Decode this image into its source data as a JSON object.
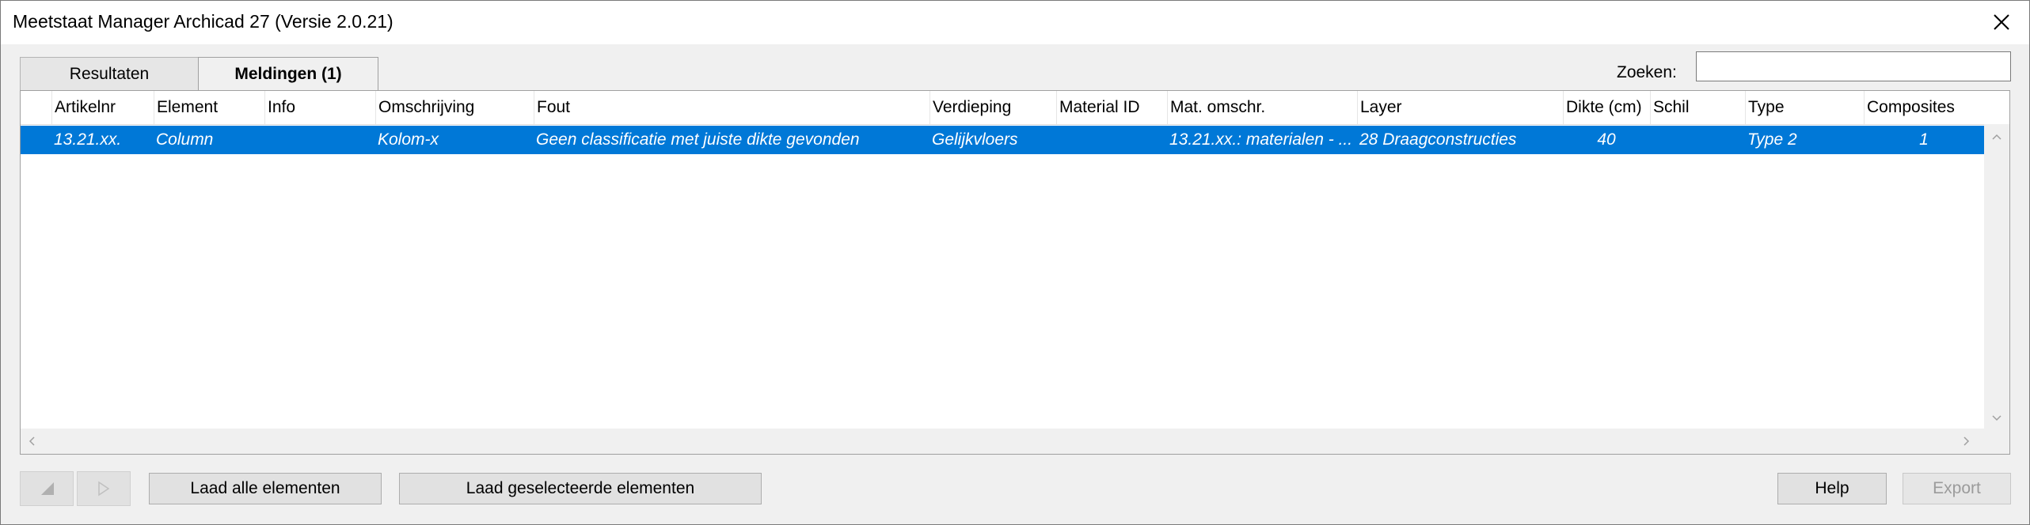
{
  "window": {
    "title": "Meetstaat Manager Archicad 27 (Versie 2.0.21)"
  },
  "tabs": [
    {
      "label": "Resultaten",
      "active": false
    },
    {
      "label": "Meldingen (1)",
      "active": true
    }
  ],
  "search": {
    "label": "Zoeken:",
    "value": "",
    "placeholder": ""
  },
  "grid": {
    "columns": [
      "Artikelnr",
      "Element",
      "Info",
      "Omschrijving",
      "Fout",
      "Verdieping",
      "Material ID",
      "Mat. omschr.",
      "Layer",
      "Dikte (cm)",
      "Schil",
      "Type",
      "Composites"
    ],
    "rows": [
      {
        "artikelnr": "13.21.xx.",
        "element": "Column",
        "info": "",
        "omschrijving": "Kolom-x",
        "fout": "Geen classificatie met juiste dikte gevonden",
        "verdieping": "Gelijkvloers",
        "material_id": "",
        "mat_omschr": "13.21.xx.: materialen - ...",
        "layer": "28 Draagconstructies",
        "dikte": "40",
        "schil": "",
        "type": "Type 2",
        "composites": "1",
        "selected": true
      }
    ]
  },
  "footer": {
    "load_all": "Laad alle elementen",
    "load_selected": "Laad geselecteerde elementen",
    "help": "Help",
    "export": "Export"
  },
  "colors": {
    "selection": "#0078d7",
    "background": "#f0f0f0"
  }
}
